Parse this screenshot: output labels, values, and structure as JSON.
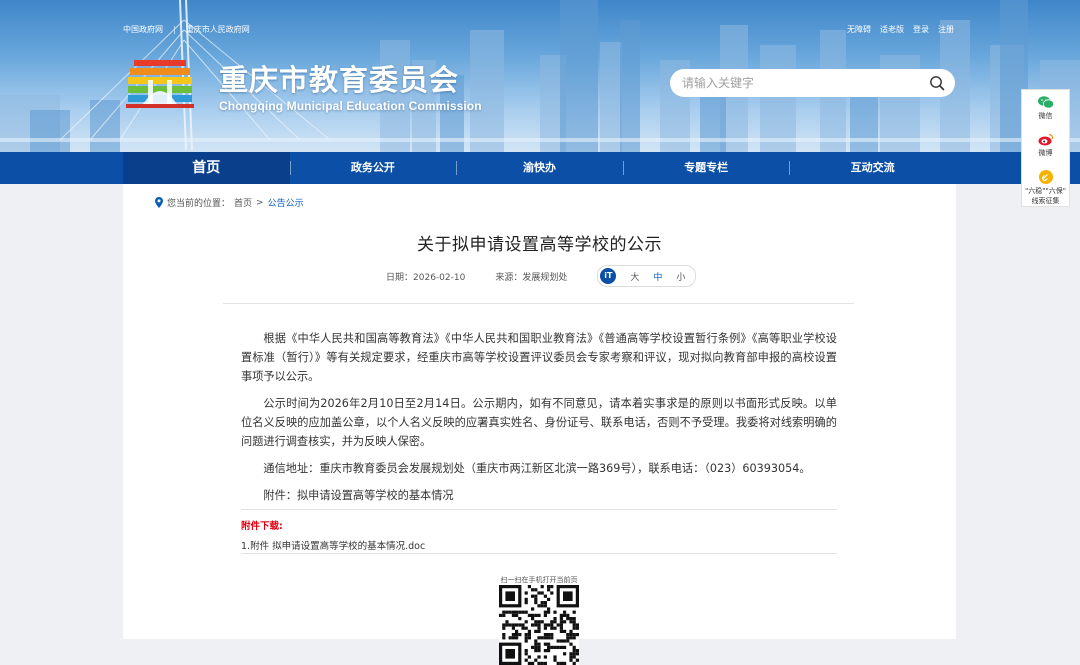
{
  "top_links": {
    "left": [
      "中国政府网",
      "重庆市人民政府网"
    ],
    "separator": "|",
    "right": [
      "无障碍",
      "适老版",
      "登录",
      "注册"
    ]
  },
  "site": {
    "title": "重庆市教育委员会",
    "subtitle": "Chongqing Municipal Education Commission"
  },
  "search": {
    "placeholder": "请输入关键字"
  },
  "nav": [
    "首页",
    "政务公开",
    "渝快办",
    "专题专栏",
    "互动交流"
  ],
  "breadcrumb": {
    "label": "您当前的位置：",
    "home": "首页",
    "sep": ">",
    "current": "公告公示"
  },
  "article": {
    "title": "关于拟申请设置高等学校的公示",
    "date_label": "日期：",
    "date": "2026-02-10",
    "source_label": "来源：",
    "source": "发展规划处",
    "fontsize": {
      "icon": "iT",
      "large": "大",
      "medium": "中",
      "small": "小"
    },
    "paragraphs": [
      "根据《中华人民共和国高等教育法》《中华人民共和国职业教育法》《普通高等学校设置暂行条例》《高等职业学校设置标准（暂行）》等有关规定要求，经重庆市高等学校设置评议委员会专家考察和评议，现对拟向教育部申报的高校设置事项予以公示。",
      "公示时间为2026年2月10日至2月14日。公示期内，如有不同意见，请本着实事求是的原则以书面形式反映。以单位名义反映的应加盖公章，以个人名义反映的应署真实姓名、身份证号、联系电话，否则不予受理。我委将对线索明确的问题进行调查核实，并为反映人保密。",
      "通信地址：重庆市教育委员会发展规划处（重庆市两江新区北滨一路369号），联系电话：（023）60393054。",
      "附件：拟申请设置高等学校的基本情况"
    ],
    "attachments_title": "附件下载:",
    "attachment": "1.附件 拟申请设置高等学校的基本情况.doc",
    "qr_caption": "扫一扫在手机打开当前页"
  },
  "sidebar": {
    "wechat": "微信",
    "weibo": "微博",
    "report_line1": "\"六稳\"\"六保\"",
    "report_line2": "线索征集"
  },
  "colors": {
    "nav_bg": "#0b4fa6",
    "nav_active": "#0a3f8c",
    "attach_red": "#e60012",
    "link_blue": "#0b5cb8"
  }
}
